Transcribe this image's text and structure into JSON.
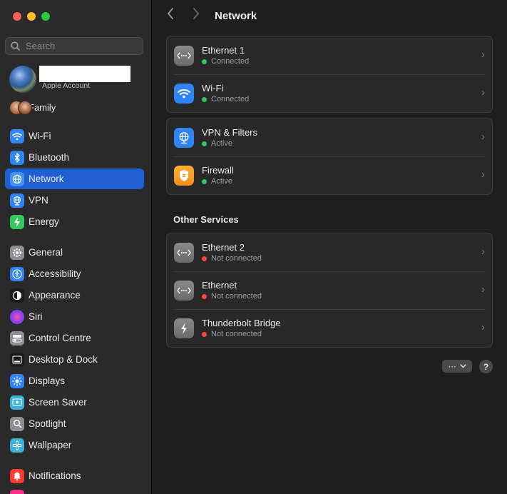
{
  "window": {
    "title": "Network"
  },
  "search": {
    "placeholder": "Search"
  },
  "account": {
    "subtitle": "Apple Account"
  },
  "family": {
    "label": "Family"
  },
  "sidebar": {
    "items": [
      {
        "label": "Wi-Fi",
        "icon": "wifi-icon",
        "color": "#2f84f6"
      },
      {
        "label": "Bluetooth",
        "icon": "bluetooth-icon",
        "color": "#2f84f6"
      },
      {
        "label": "Network",
        "icon": "globe-icon",
        "color": "#2f84f6"
      },
      {
        "label": "VPN",
        "icon": "vpn-globe-icon",
        "color": "#2f84f6"
      },
      {
        "label": "Energy",
        "icon": "bolt-icon",
        "color": "#34c759"
      },
      {
        "label": "General",
        "icon": "gear-icon",
        "color": "#8e8e93"
      },
      {
        "label": "Accessibility",
        "icon": "accessibility-icon",
        "color": "#2f84f6"
      },
      {
        "label": "Appearance",
        "icon": "appearance-icon",
        "color": "#1c1c1c"
      },
      {
        "label": "Siri",
        "icon": "siri-icon",
        "color": "#9b3fd6"
      },
      {
        "label": "Control Centre",
        "icon": "toggles-icon",
        "color": "#8e8e93"
      },
      {
        "label": "Desktop & Dock",
        "icon": "dock-icon",
        "color": "#1c1c1c"
      },
      {
        "label": "Displays",
        "icon": "sun-icon",
        "color": "#2f84f6"
      },
      {
        "label": "Screen Saver",
        "icon": "screensaver-icon",
        "color": "#3bb0d8"
      },
      {
        "label": "Spotlight",
        "icon": "magnifier-icon",
        "color": "#8e8e93"
      },
      {
        "label": "Wallpaper",
        "icon": "flower-icon",
        "color": "#3bb0d8"
      },
      {
        "label": "Notifications",
        "icon": "bell-icon",
        "color": "#ff3b30"
      }
    ],
    "selected": "Network"
  },
  "main": {
    "title": "Network",
    "group1": [
      {
        "title": "Ethernet 1",
        "status": "Connected",
        "state": "green",
        "icon": "ethernet-icon"
      },
      {
        "title": "Wi-Fi",
        "status": "Connected",
        "state": "green",
        "icon": "wifi-icon"
      }
    ],
    "group2": [
      {
        "title": "VPN & Filters",
        "status": "Active",
        "state": "green",
        "icon": "vpn-globe-icon"
      },
      {
        "title": "Firewall",
        "status": "Active",
        "state": "green",
        "icon": "firewall-shield-icon"
      }
    ],
    "other_title": "Other Services",
    "group3": [
      {
        "title": "Ethernet 2",
        "status": "Not connected",
        "state": "red",
        "icon": "ethernet-icon"
      },
      {
        "title": "Ethernet",
        "status": "Not connected",
        "state": "red",
        "icon": "ethernet-icon"
      },
      {
        "title": "Thunderbolt Bridge",
        "status": "Not connected",
        "state": "red",
        "icon": "thunderbolt-icon"
      }
    ],
    "more_label": "⋯",
    "help_label": "?"
  }
}
